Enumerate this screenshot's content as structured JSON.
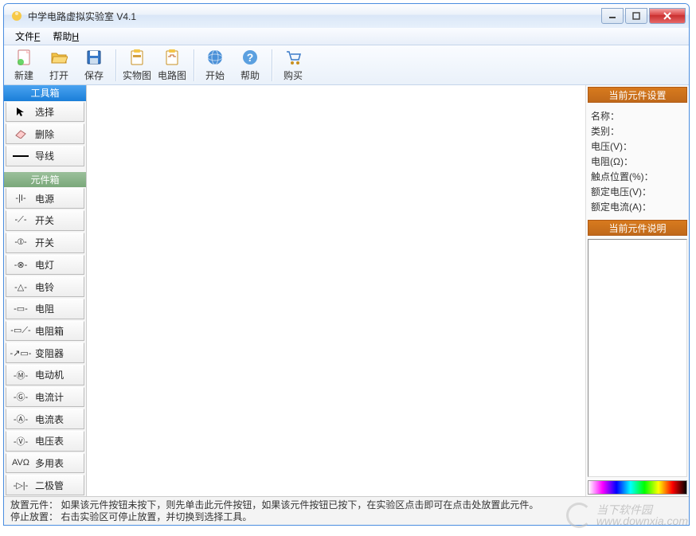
{
  "window": {
    "title": "中学电路虚拟实验室 V4.1"
  },
  "menubar": [
    {
      "label": "文件",
      "mnemonic": "F"
    },
    {
      "label": "帮助",
      "mnemonic": "H"
    }
  ],
  "toolbar": {
    "new": "新建",
    "open": "打开",
    "save": "保存",
    "physical": "实物图",
    "circuit": "电路图",
    "start": "开始",
    "help": "帮助",
    "buy": "购买"
  },
  "left": {
    "toolbox_title": "工具箱",
    "tools": [
      {
        "icon": "cursor",
        "label": "选择"
      },
      {
        "icon": "eraser",
        "label": "删除"
      },
      {
        "icon": "wire",
        "label": "导线"
      }
    ],
    "componentbox_title": "元件箱",
    "components": [
      {
        "icon": "-|I-",
        "label": "电源"
      },
      {
        "icon": "-⟋-",
        "label": "开关"
      },
      {
        "icon": "-⦶-",
        "label": "开关"
      },
      {
        "icon": "-⊗-",
        "label": "电灯"
      },
      {
        "icon": "-△-",
        "label": "电铃"
      },
      {
        "icon": "-▭-",
        "label": "电阻"
      },
      {
        "icon": "-▭⟋-",
        "label": "电阻箱"
      },
      {
        "icon": "-↗▭-",
        "label": "变阻器"
      },
      {
        "icon": "-Ⓜ-",
        "label": "电动机"
      },
      {
        "icon": "-Ⓖ-",
        "label": "电流计"
      },
      {
        "icon": "-Ⓐ-",
        "label": "电流表"
      },
      {
        "icon": "-Ⓥ-",
        "label": "电压表"
      },
      {
        "icon": "AVΩ",
        "label": "多用表"
      },
      {
        "icon": "-▷|-",
        "label": "二极管"
      }
    ]
  },
  "right": {
    "settings_title": "当前元件设置",
    "props": [
      "名称：",
      "类别：",
      "电压(V)：",
      "电阻(Ω)：",
      "触点位置(%)：",
      "额定电压(V)：",
      "额定电流(A)："
    ],
    "desc_title": "当前元件说明"
  },
  "status": {
    "line1": "放置元件：  如果该元件按钮未按下，则先单击此元件按钮，如果该元件按钮已按下，在实验区点击即可在点击处放置此元件。",
    "line2": "停止放置：  右击实验区可停止放置，并切换到选择工具。"
  },
  "watermark": {
    "text1": "当下软件园",
    "text2": "www.downxia.com"
  }
}
